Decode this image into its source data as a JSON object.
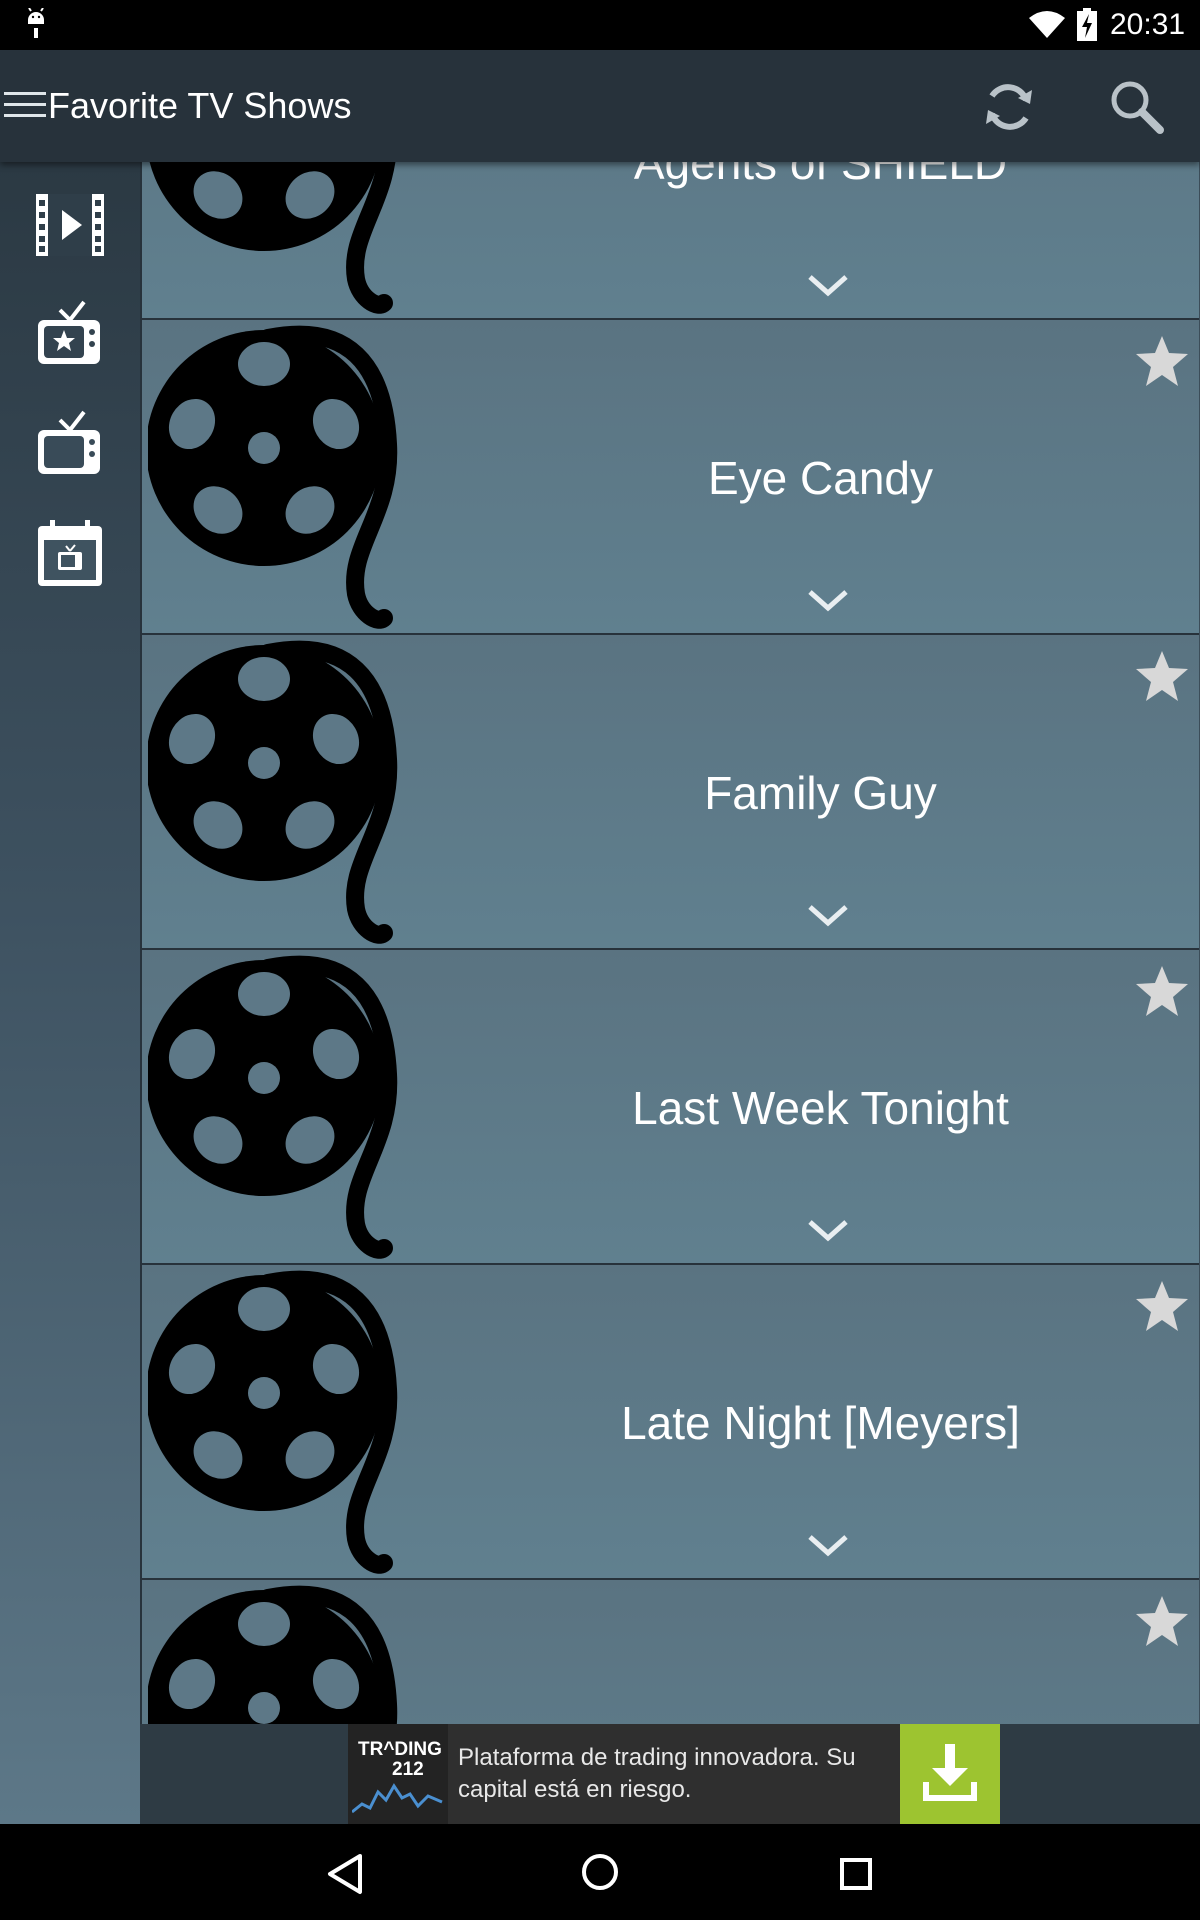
{
  "status_bar": {
    "time": "20:31",
    "icons": [
      "android-icon",
      "wifi-icon",
      "battery-charging-icon"
    ]
  },
  "app_bar": {
    "title": "Favorite TV Shows",
    "actions": [
      "refresh-icon",
      "search-icon"
    ]
  },
  "nav_rail": {
    "items": [
      {
        "icon": "movies-icon"
      },
      {
        "icon": "favorite-tv-icon"
      },
      {
        "icon": "tv-icon"
      },
      {
        "icon": "tv-calendar-icon"
      }
    ]
  },
  "shows": [
    {
      "title": "Agents of SHIELD",
      "favorite": true
    },
    {
      "title": "Eye Candy",
      "favorite": true
    },
    {
      "title": "Family Guy",
      "favorite": true
    },
    {
      "title": "Last Week Tonight",
      "favorite": true
    },
    {
      "title": "Late Night [Meyers]",
      "favorite": true
    },
    {
      "title": "",
      "favorite": true
    }
  ],
  "ad": {
    "brand_line1": "TR^DING",
    "brand_line2": "212",
    "text": "Plataforma de trading innovadora. Su capital está en riesgo.",
    "accent_color": "#9dc430"
  },
  "colors": {
    "app_bar": "#27323b",
    "row": "#5e7a89",
    "star": "#d8d8d8"
  }
}
